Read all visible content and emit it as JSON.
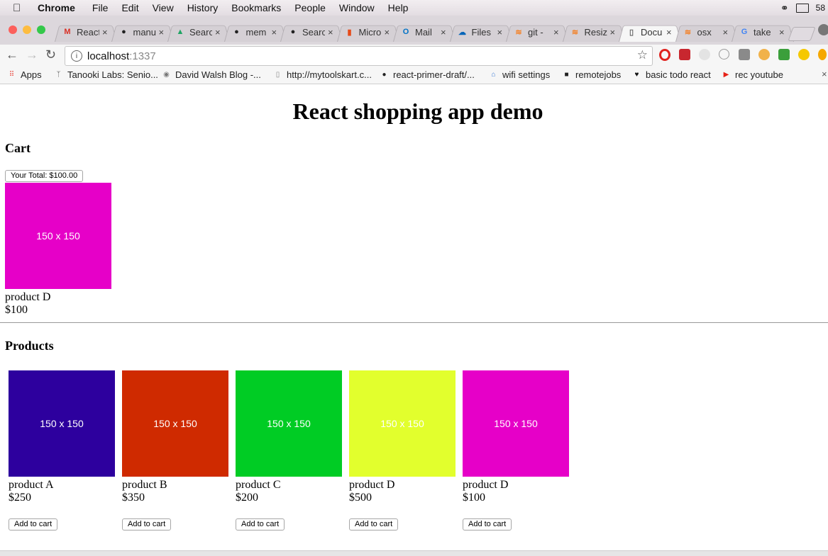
{
  "menubar": {
    "app_name": "Chrome",
    "items": [
      "File",
      "Edit",
      "View",
      "History",
      "Bookmarks",
      "People",
      "Window",
      "Help"
    ],
    "battery_text": "58"
  },
  "tabs": [
    {
      "title": "React",
      "icon": "gmail-icon",
      "color": "#d93025",
      "glyph": "M"
    },
    {
      "title": "manu",
      "icon": "github-icon",
      "color": "#222222",
      "glyph": "●"
    },
    {
      "title": "Search",
      "icon": "google-drive-icon",
      "color": "#1fa463",
      "glyph": "▲"
    },
    {
      "title": "mem",
      "icon": "github-icon",
      "color": "#222222",
      "glyph": "●"
    },
    {
      "title": "Search",
      "icon": "github-icon",
      "color": "#222222",
      "glyph": "●"
    },
    {
      "title": "Micro",
      "icon": "office-icon",
      "color": "#e64a19",
      "glyph": "▮"
    },
    {
      "title": "Mail",
      "icon": "outlook-icon",
      "color": "#0072c6",
      "glyph": "O"
    },
    {
      "title": "Files",
      "icon": "onedrive-icon",
      "color": "#0364b8",
      "glyph": "☁"
    },
    {
      "title": "git -",
      "icon": "stackoverflow-icon",
      "color": "#f48024",
      "glyph": "≋"
    },
    {
      "title": "Resiz",
      "icon": "stackoverflow-icon",
      "color": "#f48024",
      "glyph": "≋"
    },
    {
      "title": "Docu",
      "icon": "document-icon",
      "color": "#666666",
      "glyph": "▯",
      "active": true
    },
    {
      "title": "osx",
      "icon": "stackoverflow-icon",
      "color": "#f48024",
      "glyph": "≋"
    },
    {
      "title": "take",
      "icon": "google-icon",
      "color": "#4285f4",
      "glyph": "G"
    }
  ],
  "omnibox": {
    "host": "localhost",
    "port": ":1337"
  },
  "bookmarks": [
    {
      "label": "Apps",
      "icon": "apps-grid-icon",
      "color": "#e8453c",
      "glyph": "⠿"
    },
    {
      "label": "Tanooki Labs: Senio...",
      "icon": "tanooki-icon",
      "color": "#555555",
      "glyph": "ᛉ"
    },
    {
      "label": "David Walsh Blog -...",
      "icon": "david-walsh-icon",
      "color": "#777777",
      "glyph": "◉"
    },
    {
      "label": "http://mytoolskart.c...",
      "icon": "page-icon",
      "color": "#888888",
      "glyph": "▯"
    },
    {
      "label": "react-primer-draft/...",
      "icon": "github-icon",
      "color": "#222222",
      "glyph": "●"
    },
    {
      "label": "wifi settings",
      "icon": "router-icon",
      "color": "#3a7bd5",
      "glyph": "⌂"
    },
    {
      "label": "remotejobs",
      "icon": "remotejobs-icon",
      "color": "#222222",
      "glyph": "■"
    },
    {
      "label": "basic todo react",
      "icon": "broken-heart-icon",
      "color": "#111111",
      "glyph": "♥"
    },
    {
      "label": "rec youtube",
      "icon": "youtube-icon",
      "color": "#e62117",
      "glyph": "▶"
    }
  ],
  "page": {
    "title": "React shopping app demo",
    "cart_heading": "Cart",
    "total_label": "Your Total: $100.00",
    "cart_items": [
      {
        "name": "product D",
        "price": "$100",
        "image_text": "150 x 150",
        "color": "#e600c8"
      }
    ],
    "products_heading": "Products",
    "add_label": "Add to cart",
    "products": [
      {
        "name": "product A",
        "price": "$250",
        "image_text": "150 x 150",
        "color": "#2d009e"
      },
      {
        "name": "product B",
        "price": "$350",
        "image_text": "150 x 150",
        "color": "#cf2a00"
      },
      {
        "name": "product C",
        "price": "$200",
        "image_text": "150 x 150",
        "color": "#00cc24"
      },
      {
        "name": "product D",
        "price": "$500",
        "image_text": "150 x 150",
        "color": "#e2ff2d"
      },
      {
        "name": "product D",
        "price": "$100",
        "image_text": "150 x 150",
        "color": "#e600c8"
      }
    ]
  }
}
